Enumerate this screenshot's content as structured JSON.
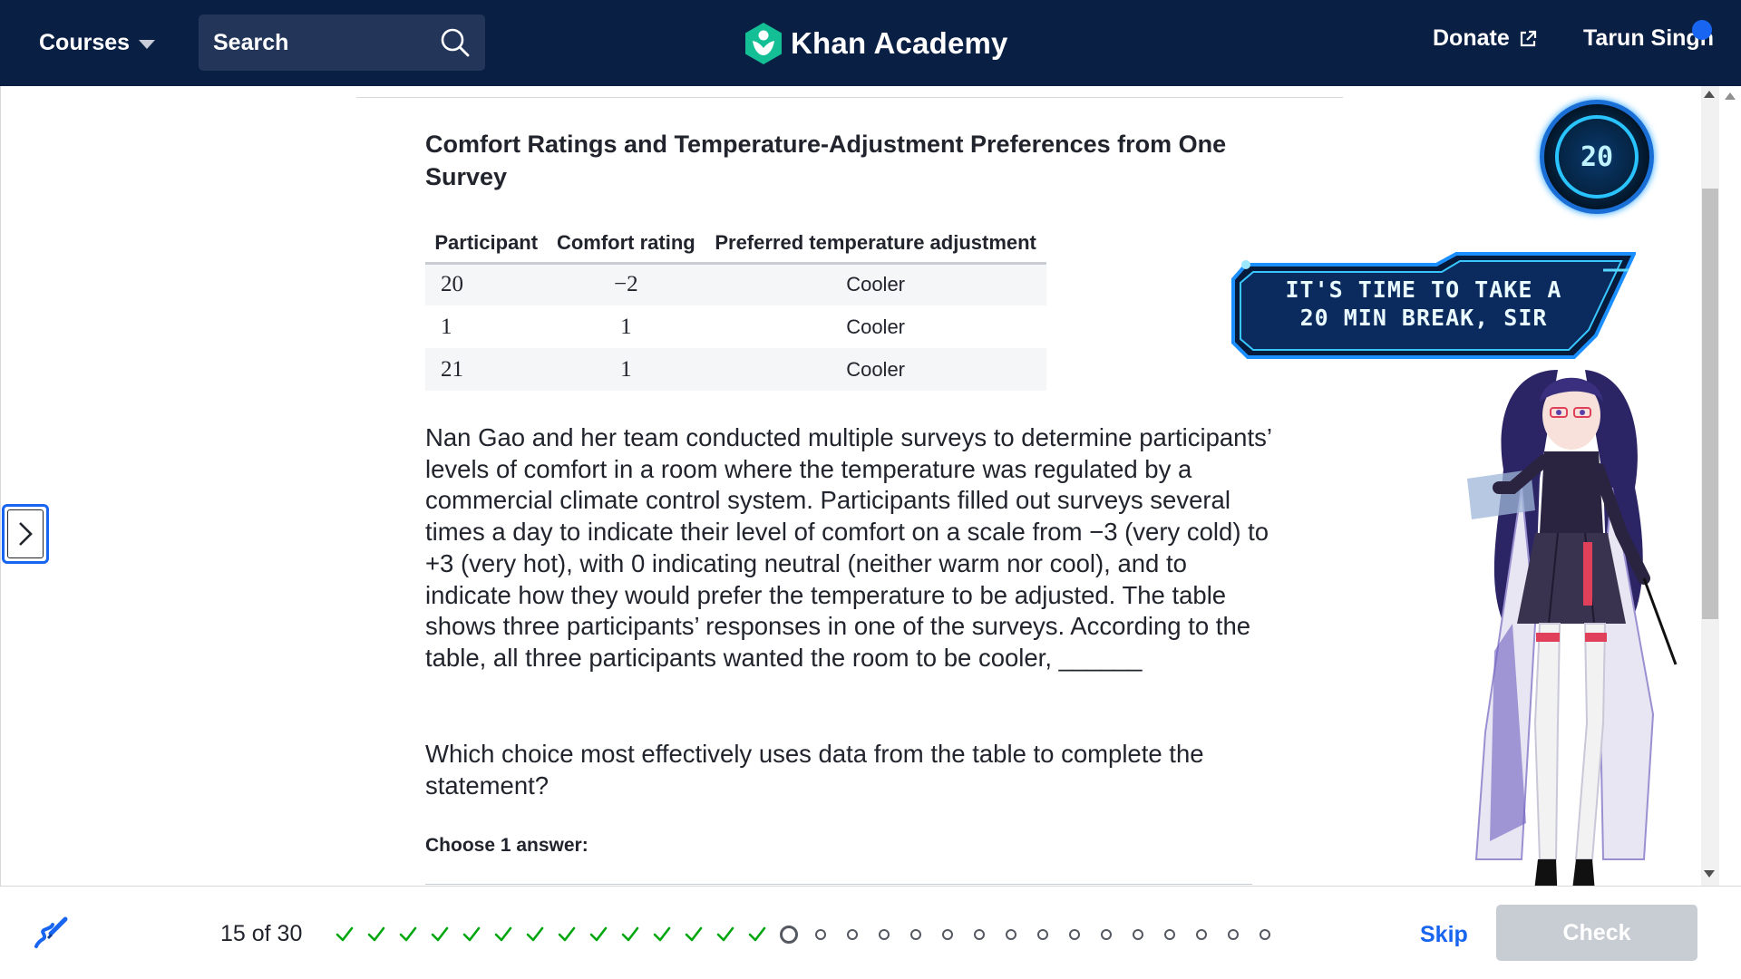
{
  "nav": {
    "courses_label": "Courses",
    "search_placeholder": "Search",
    "logo_text": "Khan Academy",
    "donate_label": "Donate",
    "user_name": "Tarun Singh"
  },
  "question": {
    "table_title": "Comfort Ratings and Temperature-Adjustment Preferences from One Survey",
    "table": {
      "headers": [
        "Participant",
        "Comfort rating",
        "Preferred temperature adjustment"
      ],
      "rows": [
        [
          "20",
          "−2",
          "Cooler"
        ],
        [
          "1",
          "1",
          "Cooler"
        ],
        [
          "21",
          "1",
          "Cooler"
        ]
      ]
    },
    "passage": "Nan Gao and her team conducted multiple surveys to determine participants’ levels of comfort in a room where the temperature was regulated by a commercial climate control system. Participants filled out surveys several times a day to indicate their level of comfort on a scale from −3 (very cold) to +3 (very hot), with 0 indicating neutral (neither warm nor cool), and to indicate how they would prefer the temperature to be adjusted. The table shows three participants’ responses in one of the surveys. According to the table, all three participants wanted the room to be cooler, ______",
    "prompt": "Which choice most effectively uses data from the table to complete the statement?",
    "choose_label": "Choose 1 answer:"
  },
  "overlay": {
    "timer_value": "20",
    "banner_line1": "IT'S TIME TO TAKE A",
    "banner_line2": "20 MIN BREAK, SIR"
  },
  "footer": {
    "progress_label": "15 of 30",
    "completed": 14,
    "current": 15,
    "total": 30,
    "skip_label": "Skip",
    "check_label": "Check"
  },
  "colors": {
    "nav_bg": "#0a1f44",
    "accent": "#1865f2",
    "check_green": "#00a60e",
    "disabled_btn": "#c8ccd3"
  }
}
